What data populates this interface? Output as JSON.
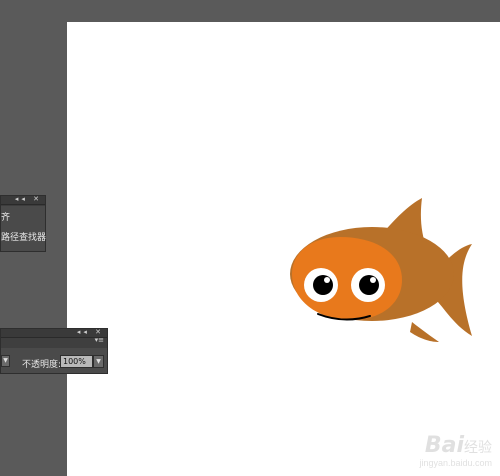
{
  "panels": {
    "align": {
      "row1": "齐",
      "row2": "路径查找器",
      "controls": "◂◂ ✕"
    },
    "transparency": {
      "controls": "◂◂ ✕",
      "menu_icon": "▾≡",
      "opacity_label": "不透明度:",
      "opacity_value": "100%",
      "dropdown_arrow": "▼"
    }
  },
  "artwork": {
    "body_color": "#b87129",
    "face_color": "#e8791c",
    "eye_color": "#000000"
  },
  "watermark": {
    "logo": "Bai",
    "logo_cn": "经验",
    "url": "jingyan.baidu.com"
  }
}
